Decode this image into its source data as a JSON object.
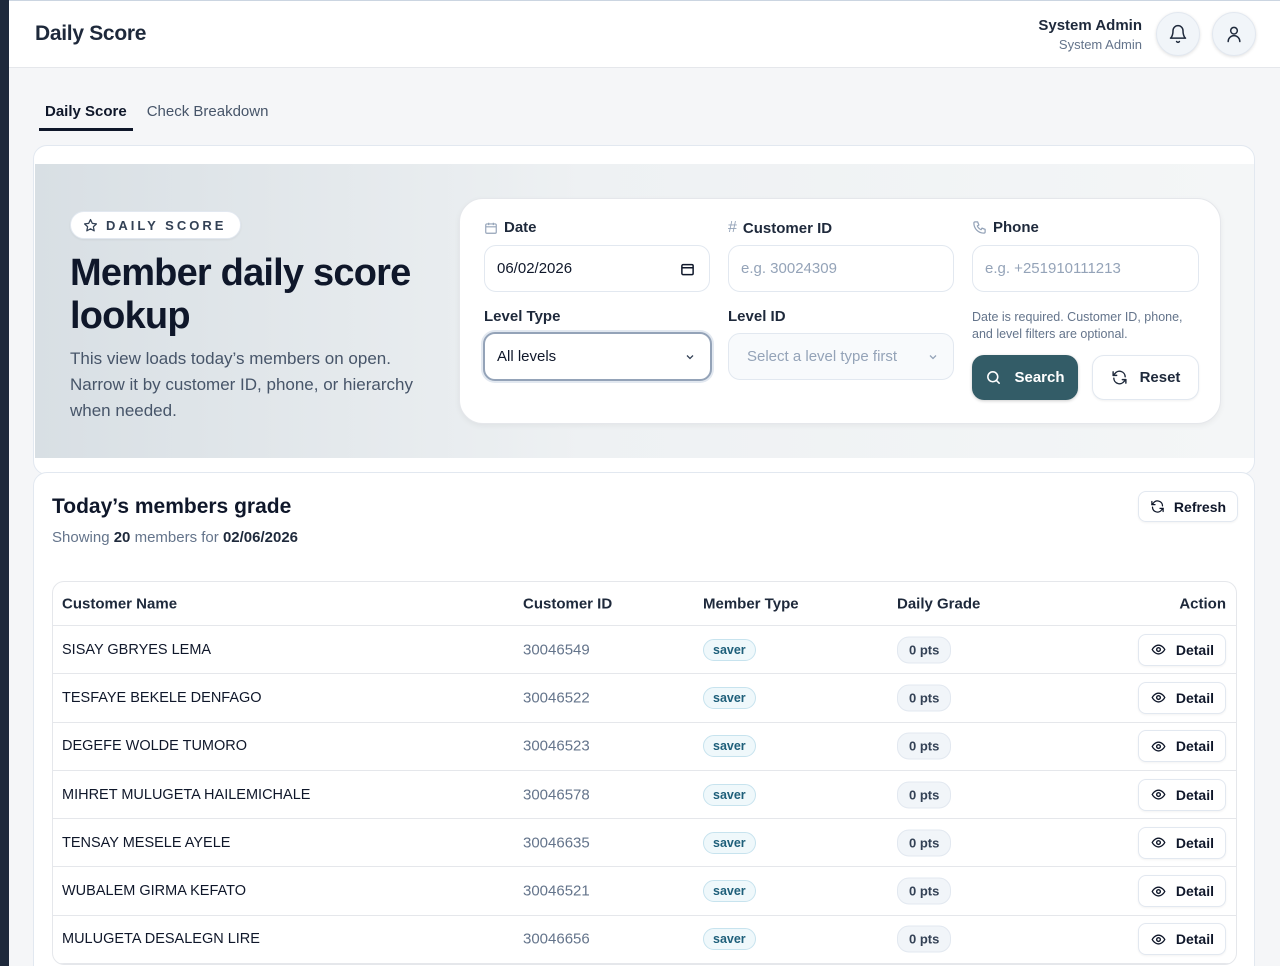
{
  "header": {
    "brand": "Daily Score",
    "user_name": "System Admin",
    "user_role": "System Admin"
  },
  "tabs": [
    {
      "label": "Daily Score",
      "active": true
    },
    {
      "label": "Check Breakdown",
      "active": false
    }
  ],
  "hero": {
    "badge": "DAILY SCORE",
    "title": "Member daily score lookup",
    "description": "This view loads today’s members on open. Narrow it by customer ID, phone, or hierarchy when needed."
  },
  "form": {
    "date_label": "Date",
    "date_value": "06/02/2026",
    "customer_id_label": "Customer ID",
    "customer_id_placeholder": "e.g. 30024309",
    "phone_label": "Phone",
    "phone_placeholder": "e.g. +251910111213",
    "level_type_label": "Level Type",
    "level_type_value": "All levels",
    "level_id_label": "Level ID",
    "level_id_placeholder": "Select a level type first",
    "hint": "Date is required. Customer ID, phone, and level filters are optional.",
    "search_label": "Search",
    "reset_label": "Reset"
  },
  "results": {
    "title": "Today’s members grade",
    "showing_prefix": "Showing",
    "count": "20",
    "showing_mid": "members for",
    "date": "02/06/2026",
    "refresh_label": "Refresh",
    "columns": [
      "Customer Name",
      "Customer ID",
      "Member Type",
      "Daily Grade",
      "Action"
    ],
    "rows": [
      {
        "name": "SISAY GBRYES LEMA",
        "id": "30046549",
        "type": "saver",
        "grade": "0 pts",
        "action": "Detail"
      },
      {
        "name": "TESFAYE BEKELE DENFAGO",
        "id": "30046522",
        "type": "saver",
        "grade": "0 pts",
        "action": "Detail"
      },
      {
        "name": "DEGEFE WOLDE TUMORO",
        "id": "30046523",
        "type": "saver",
        "grade": "0 pts",
        "action": "Detail"
      },
      {
        "name": "MIHRET MULUGETA HAILEMICHALE",
        "id": "30046578",
        "type": "saver",
        "grade": "0 pts",
        "action": "Detail"
      },
      {
        "name": "TENSAY MESELE AYELE",
        "id": "30046635",
        "type": "saver",
        "grade": "0 pts",
        "action": "Detail"
      },
      {
        "name": "WUBALEM GIRMA KEFATO",
        "id": "30046521",
        "type": "saver",
        "grade": "0 pts",
        "action": "Detail"
      },
      {
        "name": "MULUGETA DESALEGN LIRE",
        "id": "30046656",
        "type": "saver",
        "grade": "0 pts",
        "action": "Detail"
      }
    ]
  },
  "colors": {
    "primary": "#335c67",
    "sidebar": "#1e293b"
  }
}
